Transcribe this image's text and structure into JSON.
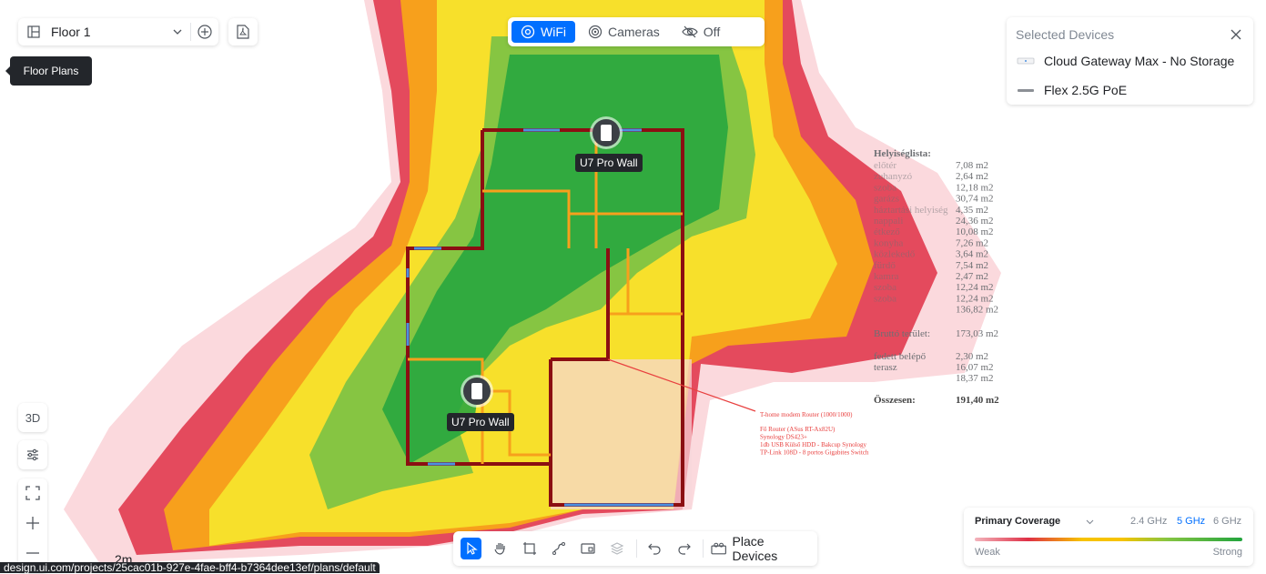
{
  "floor": {
    "name": "Floor 1"
  },
  "tooltip": {
    "text": "Floor Plans"
  },
  "modes": [
    {
      "label": "WiFi",
      "icon": "wifi-target-icon",
      "active": true
    },
    {
      "label": "Cameras",
      "icon": "camera-icon",
      "active": false
    },
    {
      "label": "Off",
      "icon": "eye-off-icon",
      "active": false
    }
  ],
  "selected": {
    "title": "Selected Devices",
    "devices": [
      {
        "name": "Cloud Gateway Max - No Storage",
        "icon": "gateway-icon"
      },
      {
        "name": "Flex 2.5G PoE",
        "icon": "switch-icon"
      }
    ]
  },
  "access_points": [
    {
      "label": "U7 Pro Wall"
    },
    {
      "label": "U7 Pro Wall"
    }
  ],
  "left_tools": {
    "view3d": "3D"
  },
  "scale": {
    "label": "2m"
  },
  "bottom_toolbar": {
    "place_label": "Place Devices"
  },
  "coverage": {
    "title": "Primary Coverage",
    "bands": [
      "2.4 GHz",
      "5 GHz",
      "6 GHz"
    ],
    "active_band": "5 GHz",
    "weak": "Weak",
    "strong": "Strong"
  },
  "status_url": "design.ui.com/projects/25cac01b-927e-4fae-bff4-b7364dee13ef/plans/default",
  "floorplan_legend": {
    "title": "Helyiséglista:",
    "rows": [
      {
        "name": "előtér",
        "value": "7,08 m2"
      },
      {
        "name": "zuhanyzó",
        "value": "2,64 m2"
      },
      {
        "name": "szoba",
        "value": "12,18 m2"
      },
      {
        "name": "garázs",
        "value": "30,74 m2"
      },
      {
        "name": "háztartási helyiség",
        "value": "4,35 m2"
      },
      {
        "name": "nappali",
        "value": "24,36 m2"
      },
      {
        "name": "étkező",
        "value": "10,08 m2"
      },
      {
        "name": "konyha",
        "value": "7,26 m2"
      },
      {
        "name": "közlekedő",
        "value": "3,64 m2"
      },
      {
        "name": "fürdő",
        "value": "7,54 m2"
      },
      {
        "name": "kamra",
        "value": "2,47 m2"
      },
      {
        "name": "szoba",
        "value": "12,24 m2"
      },
      {
        "name": "szoba",
        "value": "12,24 m2"
      },
      {
        "name": "",
        "value": "136,82 m2"
      }
    ],
    "brutto_label": "Bruttó terület:",
    "brutto_value": "173,03 m2",
    "fedett_label": "fedett belépő",
    "fedett_value": "2,30 m2",
    "terasz_label": "terasz",
    "terasz_value": "16,07 m2",
    "extra_value": "18,37 m2",
    "total_label": "Összesen:",
    "total_value": "191,40 m2"
  },
  "floorplan_notes": {
    "red_lines": [
      "T-home modem Router (1000/1000)",
      "Fő Router (ASus RT-Ax82U)",
      "Synology DS423+",
      "1db USB Külső HDD - Bakcup Synology",
      "TP-Link 108D - 8 portos Gigabites Switch"
    ]
  },
  "colors": {
    "accent": "#006fff",
    "heat_weak": "#f3b4bc",
    "heat_red": "#df3046",
    "heat_orange": "#f7a01c",
    "heat_yellow": "#f7e02b",
    "heat_lightgreen": "#86c542",
    "heat_green": "#22a43e",
    "wall": "#8b0f12"
  }
}
